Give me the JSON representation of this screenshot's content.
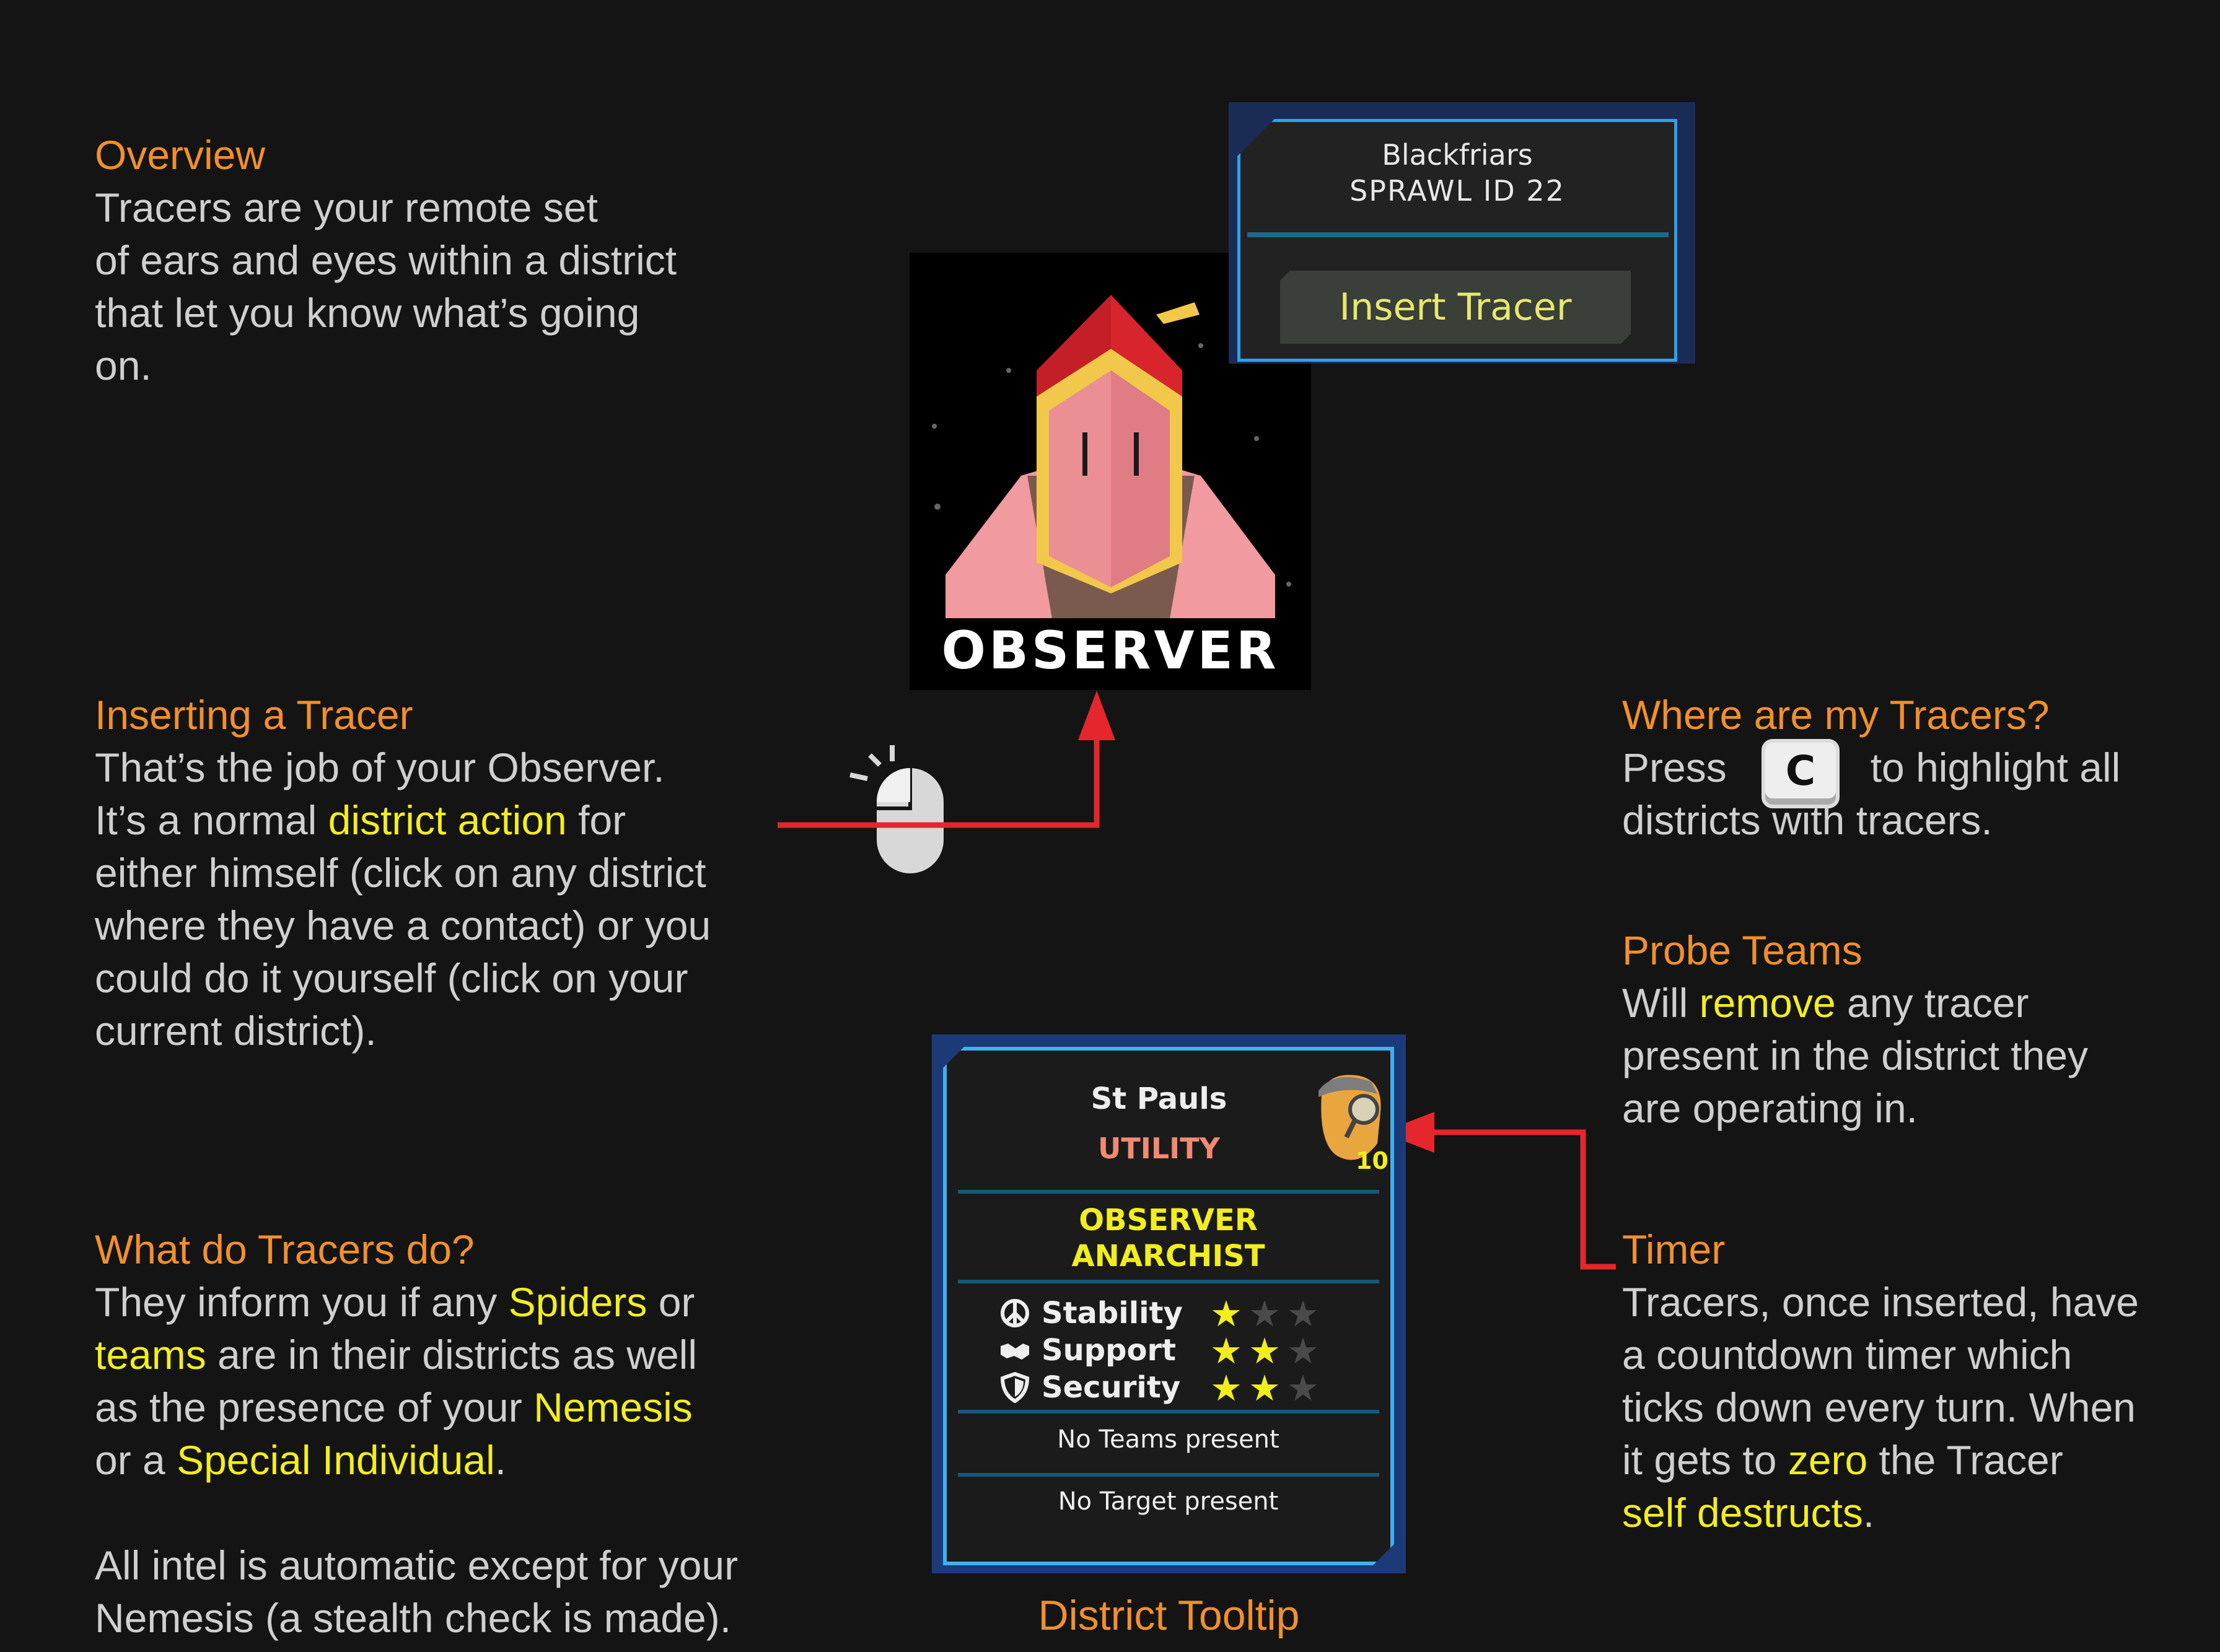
{
  "overview": {
    "heading": "Overview",
    "lines": [
      "Tracers are your remote set",
      "of ears and eyes within a district",
      "that let you know what’s going",
      "on."
    ]
  },
  "inserting": {
    "heading": "Inserting a Tracer",
    "line1": "That’s the job of your Observer.",
    "line2_pre": "It’s a normal ",
    "line2_hl": "district action",
    "line2_post": " for",
    "lines_rest": [
      "either himself (click on any district",
      "where they have a contact) or you",
      "could do it yourself (click on your",
      "current district)."
    ]
  },
  "what_do": {
    "heading": "What do Tracers do?",
    "l1_pre": "They inform you if any ",
    "l1_hl": "Spiders",
    "l1_post": " or",
    "l2_hl": "teams",
    "l2_post": " are in their districts as well",
    "l3_pre": "as the presence of your ",
    "l3_hl": "Nemesis",
    "l4_pre": "or a ",
    "l4_hl": "Special Individual",
    "l4_post": ".",
    "l5": "All intel is automatic except for your",
    "l6": "Nemesis (a stealth check is made)."
  },
  "where": {
    "heading": "Where are my Tracers?",
    "press": "Press",
    "key": "C",
    "after_key": "to highlight all",
    "line2": "districts with tracers."
  },
  "probe": {
    "heading": "Probe Teams",
    "l1_pre": "Will ",
    "l1_hl": "remove",
    "l1_post": " any tracer",
    "l2": "present in the district they",
    "l3": "are operating in."
  },
  "timer": {
    "heading": "Timer",
    "l1": "Tracers, once inserted, have",
    "l2": "a countdown timer which",
    "l3": "ticks down every turn. When",
    "l4_pre": "it gets to ",
    "l4_hl": "zero",
    "l4_post": " the Tracer",
    "l5_hl": "self destructs",
    "l5_post": "."
  },
  "observer": {
    "label": "OBSERVER"
  },
  "district_panel": {
    "name": "Blackfriars",
    "sprawl": "SPRAWL ID 22",
    "button": "Insert Tracer"
  },
  "tooltip": {
    "district": "St Pauls",
    "type": "UTILITY",
    "badge": "10",
    "role1": "OBSERVER",
    "role2": "ANARCHIST",
    "stats": [
      {
        "label": "Stability",
        "icon": "peace-icon",
        "stars": 1
      },
      {
        "label": "Support",
        "icon": "handshake-icon",
        "stars": 2
      },
      {
        "label": "Security",
        "icon": "shield-icon",
        "stars": 2
      }
    ],
    "max_stars": 3,
    "teams": "No Teams present",
    "target": "No Target present",
    "caption": "District Tooltip"
  },
  "colors": {
    "heading": "#f0902c",
    "highlight": "#f2ee1e",
    "body_text": "#cfcfcf",
    "arrow": "#e5262c",
    "panel_border": "#2fa0ea"
  }
}
